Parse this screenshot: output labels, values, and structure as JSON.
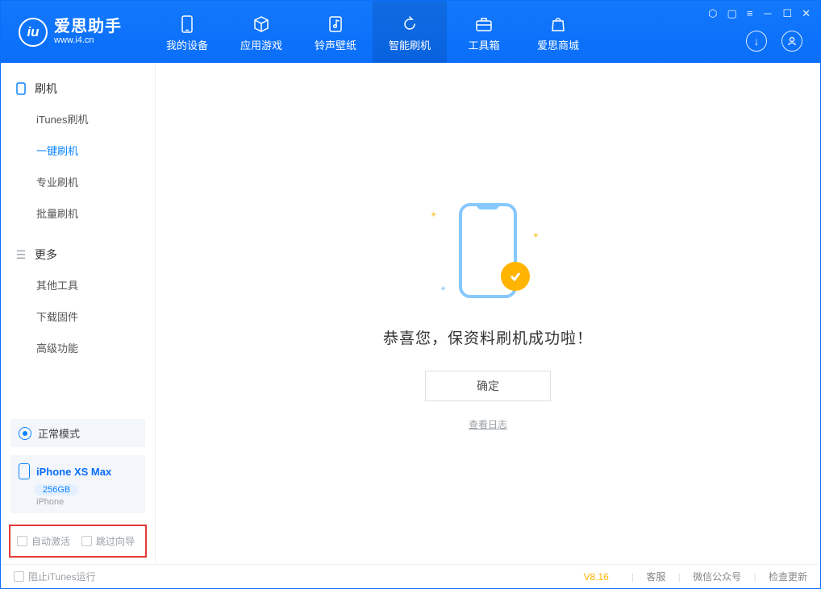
{
  "app": {
    "title": "爱思助手",
    "subtitle": "www.i4.cn"
  },
  "nav": {
    "tabs": [
      {
        "label": "我的设备",
        "icon": "device"
      },
      {
        "label": "应用游戏",
        "icon": "cube"
      },
      {
        "label": "铃声壁纸",
        "icon": "note"
      },
      {
        "label": "智能刷机",
        "icon": "refresh",
        "active": true
      },
      {
        "label": "工具箱",
        "icon": "toolbox"
      },
      {
        "label": "爱思商城",
        "icon": "bag"
      }
    ]
  },
  "sidebar": {
    "group1": {
      "title": "刷机",
      "items": [
        "iTunes刷机",
        "一键刷机",
        "专业刷机",
        "批量刷机"
      ],
      "activeIndex": 1
    },
    "group2": {
      "title": "更多",
      "items": [
        "其他工具",
        "下载固件",
        "高级功能"
      ]
    },
    "mode": "正常模式",
    "device": {
      "name": "iPhone XS Max",
      "storage": "256GB",
      "type": "iPhone"
    },
    "options": {
      "autoActivate": "自动激活",
      "skipGuide": "跳过向导"
    }
  },
  "content": {
    "successTitle": "恭喜您，保资料刷机成功啦！",
    "okButton": "确定",
    "logLink": "查看日志"
  },
  "statusbar": {
    "blockItunes": "阻止iTunes运行",
    "version": "V8.16",
    "links": [
      "客服",
      "微信公众号",
      "检查更新"
    ]
  }
}
